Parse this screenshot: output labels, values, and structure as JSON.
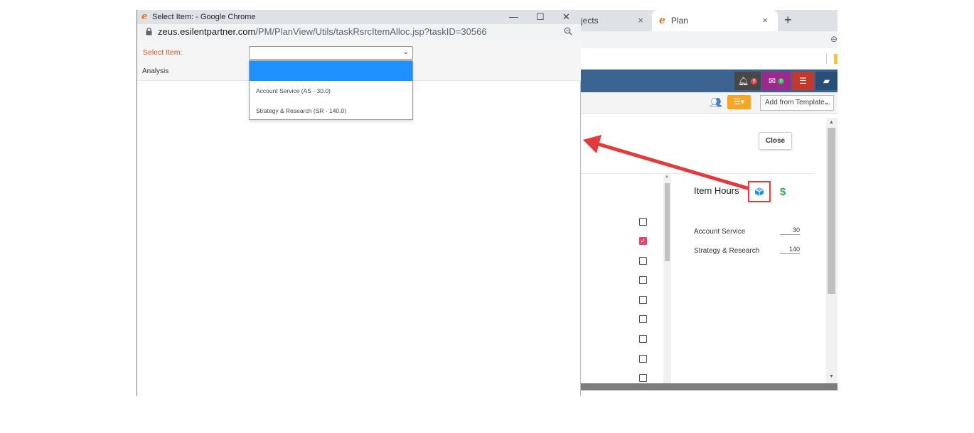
{
  "background_browser": {
    "tabs": [
      {
        "label": "jects",
        "close": "×"
      },
      {
        "label": "Plan",
        "close": "×"
      }
    ],
    "new_tab": "+",
    "toolbar": {
      "template_select": "Add from Template..."
    },
    "nav_badges": {
      "notifications": "0",
      "messages": "0"
    },
    "modal": {
      "close_label": "Close",
      "section_title": "Item Hours",
      "currency_symbol": "$",
      "items": [
        {
          "name": "Account Service",
          "hours": "30"
        },
        {
          "name": "Strategy & Research",
          "hours": "140"
        }
      ],
      "checkboxes": [
        false,
        true,
        false,
        false,
        false,
        false,
        false,
        false,
        false
      ]
    }
  },
  "popup": {
    "window_title": "Select Item: - Google Chrome",
    "url_host": "zeus.esilentpartner.com",
    "url_path": "/PM/PlanView/Utils/taskRsrcItemAlloc.jsp?taskID=30566",
    "select_label": "Select Item:",
    "select_value": "",
    "analysis_label": "Analysis",
    "options": [
      {
        "label": "",
        "selected": true
      },
      {
        "label": "Account Service (AS - 30.0)",
        "selected": false
      },
      {
        "label": "Strategy & Research (SR - 140.0)",
        "selected": false
      }
    ]
  },
  "colors": {
    "accent_orange": "#d9531e",
    "dropdown_highlight": "#1e90ff",
    "nav_bar": "#3a6591",
    "annotation_red": "#e23b3b",
    "check_pink": "#e8456e"
  }
}
